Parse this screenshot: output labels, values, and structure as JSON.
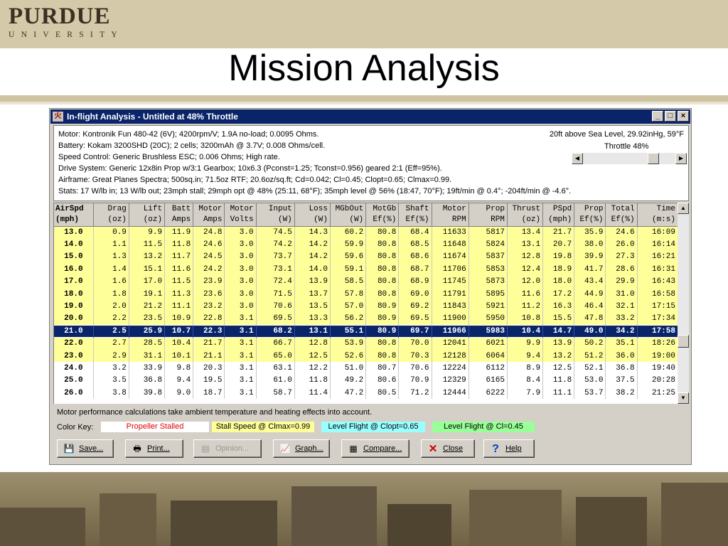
{
  "slide": {
    "logo_word": "PURDUE",
    "logo_sub": "UNIVERSITY",
    "title": "Mission Analysis"
  },
  "window": {
    "title": "In-flight Analysis - Untitled at 48% Throttle",
    "icon_glyph": "火",
    "controls": {
      "minimize": "_",
      "maximize": "□",
      "close": "×"
    }
  },
  "info": {
    "lines": [
      "Motor: Kontronik Fun 480-42 (6V); 4200rpm/V; 1.9A no-load; 0.0095 Ohms.",
      "Battery: Kokam 3200SHD (20C); 2 cells; 3200mAh @ 3.7V; 0.008 Ohms/cell.",
      "Speed Control: Generic Brushless ESC; 0.006 Ohms; High rate.",
      "Drive System: Generic 12x8in Prop w/3:1 Gearbox; 10x6.3 (Pconst=1.25; Tconst=0.956) geared 2:1 (Eff=95%).",
      "Airframe: Great Planes Spectra; 500sq.in; 71.5oz RTF; 20.6oz/sq.ft; Cd=0.042; Cl=0.45; Clopt=0.65; Clmax=0.99.",
      "Stats: 17 W/lb in; 13 W/lb out; 23mph stall; 29mph opt @ 48% (25:11, 68°F); 35mph level @ 56% (18:47, 70°F); 19ft/min @ 0.4°; -204ft/min @ -4.6°."
    ],
    "altitude": "20ft above Sea Level, 29.92inHg, 59°F",
    "throttle_label": "Throttle 48%",
    "throttle_value": 48
  },
  "table": {
    "header1": [
      "AirSpd",
      "Drag",
      "Lift",
      "Batt",
      "Motor",
      "Motor",
      "Input",
      "Loss",
      "MGbOut",
      "MotGb",
      "Shaft",
      "Motor",
      "Prop",
      "Thrust",
      "PSpd",
      "Prop",
      "Total",
      "Time"
    ],
    "header2": [
      "(mph)",
      "(oz)",
      "(oz)",
      "Amps",
      "Amps",
      "Volts",
      "(W)",
      "(W)",
      "(W)",
      "Ef(%)",
      "Ef(%)",
      "RPM",
      "RPM",
      "(oz)",
      "(mph)",
      "Ef(%)",
      "Ef(%)",
      "(m:s)"
    ],
    "rows": [
      [
        "13.0",
        "0.9",
        "9.9",
        "11.9",
        "24.8",
        "3.0",
        "74.5",
        "14.3",
        "60.2",
        "80.8",
        "68.4",
        "11633",
        "5817",
        "13.4",
        "21.7",
        "35.9",
        "24.6",
        "16:09"
      ],
      [
        "14.0",
        "1.1",
        "11.5",
        "11.8",
        "24.6",
        "3.0",
        "74.2",
        "14.2",
        "59.9",
        "80.8",
        "68.5",
        "11648",
        "5824",
        "13.1",
        "20.7",
        "38.0",
        "26.0",
        "16:14"
      ],
      [
        "15.0",
        "1.3",
        "13.2",
        "11.7",
        "24.5",
        "3.0",
        "73.7",
        "14.2",
        "59.6",
        "80.8",
        "68.6",
        "11674",
        "5837",
        "12.8",
        "19.8",
        "39.9",
        "27.3",
        "16:21"
      ],
      [
        "16.0",
        "1.4",
        "15.1",
        "11.6",
        "24.2",
        "3.0",
        "73.1",
        "14.0",
        "59.1",
        "80.8",
        "68.7",
        "11706",
        "5853",
        "12.4",
        "18.9",
        "41.7",
        "28.6",
        "16:31"
      ],
      [
        "17.0",
        "1.6",
        "17.0",
        "11.5",
        "23.9",
        "3.0",
        "72.4",
        "13.9",
        "58.5",
        "80.8",
        "68.9",
        "11745",
        "5873",
        "12.0",
        "18.0",
        "43.4",
        "29.9",
        "16:43"
      ],
      [
        "18.0",
        "1.8",
        "19.1",
        "11.3",
        "23.6",
        "3.0",
        "71.5",
        "13.7",
        "57.8",
        "80.8",
        "69.0",
        "11791",
        "5895",
        "11.6",
        "17.2",
        "44.9",
        "31.0",
        "16:58"
      ],
      [
        "19.0",
        "2.0",
        "21.2",
        "11.1",
        "23.2",
        "3.0",
        "70.6",
        "13.5",
        "57.0",
        "80.9",
        "69.2",
        "11843",
        "5921",
        "11.2",
        "16.3",
        "46.4",
        "32.1",
        "17:15"
      ],
      [
        "20.0",
        "2.2",
        "23.5",
        "10.9",
        "22.8",
        "3.1",
        "69.5",
        "13.3",
        "56.2",
        "80.9",
        "69.5",
        "11900",
        "5950",
        "10.8",
        "15.5",
        "47.8",
        "33.2",
        "17:34"
      ],
      [
        "21.0",
        "2.5",
        "25.9",
        "10.7",
        "22.3",
        "3.1",
        "68.2",
        "13.1",
        "55.1",
        "80.9",
        "69.7",
        "11966",
        "5983",
        "10.4",
        "14.7",
        "49.0",
        "34.2",
        "17:58"
      ],
      [
        "22.0",
        "2.7",
        "28.5",
        "10.4",
        "21.7",
        "3.1",
        "66.7",
        "12.8",
        "53.9",
        "80.8",
        "70.0",
        "12041",
        "6021",
        "9.9",
        "13.9",
        "50.2",
        "35.1",
        "18:26"
      ],
      [
        "23.0",
        "2.9",
        "31.1",
        "10.1",
        "21.1",
        "3.1",
        "65.0",
        "12.5",
        "52.6",
        "80.8",
        "70.3",
        "12128",
        "6064",
        "9.4",
        "13.2",
        "51.2",
        "36.0",
        "19:00"
      ],
      [
        "24.0",
        "3.2",
        "33.9",
        "9.8",
        "20.3",
        "3.1",
        "63.1",
        "12.2",
        "51.0",
        "80.7",
        "70.6",
        "12224",
        "6112",
        "8.9",
        "12.5",
        "52.1",
        "36.8",
        "19:40"
      ],
      [
        "25.0",
        "3.5",
        "36.8",
        "9.4",
        "19.5",
        "3.1",
        "61.0",
        "11.8",
        "49.2",
        "80.6",
        "70.9",
        "12329",
        "6165",
        "8.4",
        "11.8",
        "53.0",
        "37.5",
        "20:28"
      ],
      [
        "26.0",
        "3.8",
        "39.8",
        "9.0",
        "18.7",
        "3.1",
        "58.7",
        "11.4",
        "47.2",
        "80.5",
        "71.2",
        "12444",
        "6222",
        "7.9",
        "11.1",
        "53.7",
        "38.2",
        "21:25"
      ]
    ],
    "row_styles": [
      "stall",
      "stall",
      "stall",
      "stall",
      "stall",
      "stall",
      "stall",
      "stall",
      "sel",
      "stall",
      "stall",
      "white",
      "white",
      "white"
    ],
    "selected_row": 8
  },
  "footer": {
    "note": "Motor performance calculations take ambient temperature and heating effects into account.",
    "color_key_label": "Color Key:",
    "keys": [
      {
        "label": "Propeller Stalled",
        "bg": "#ffffff",
        "fg": "#e00000"
      },
      {
        "label": "Stall Speed @ Clmax=0.99",
        "bg": "#ffff99",
        "fg": "#000000"
      },
      {
        "label": "Level Flight @ Clopt=0.65",
        "bg": "#99ffff",
        "fg": "#000000"
      },
      {
        "label": "Level Flight @ Cl=0.45",
        "bg": "#99ff99",
        "fg": "#000000"
      }
    ],
    "buttons": {
      "save": "Save...",
      "print": "Print...",
      "opinion": "Opinion...",
      "graph": "Graph...",
      "compare": "Compare...",
      "close": "Close",
      "help": "Help"
    }
  },
  "colors": {
    "titlebar": "#0a246a",
    "selected_row": "#0a246a",
    "stall_row": "#ffff99",
    "header_band": "#d4c9a8"
  }
}
